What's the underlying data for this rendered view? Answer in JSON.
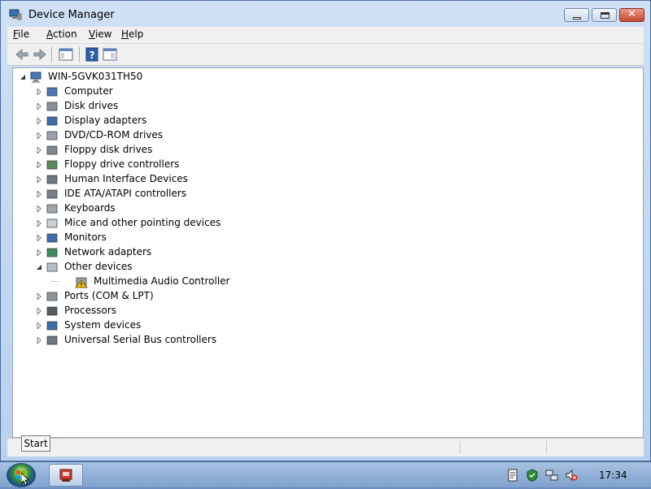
{
  "window": {
    "title": "Device Manager",
    "menu": [
      {
        "mnemonic": "F",
        "rest": "ile"
      },
      {
        "mnemonic": "A",
        "rest": "ction"
      },
      {
        "mnemonic": "V",
        "rest": "iew"
      },
      {
        "mnemonic": "H",
        "rest": "elp"
      }
    ],
    "toolbar": [
      "back-icon",
      "forward-icon",
      "show-hide-console-tree-icon",
      "help-icon",
      "action-pane-icon"
    ],
    "caption_buttons": [
      "minimize-icon",
      "maximize-icon",
      "close-icon"
    ]
  },
  "tree": {
    "root": "WIN-5GVK031TH50",
    "categories": [
      {
        "label": "Computer",
        "icon": "computer-icon"
      },
      {
        "label": "Disk drives",
        "icon": "disk-drive-icon"
      },
      {
        "label": "Display adapters",
        "icon": "display-adapter-icon"
      },
      {
        "label": "DVD/CD-ROM drives",
        "icon": "dvd-drive-icon"
      },
      {
        "label": "Floppy disk drives",
        "icon": "floppy-disk-icon"
      },
      {
        "label": "Floppy drive controllers",
        "icon": "floppy-controller-icon"
      },
      {
        "label": "Human Interface Devices",
        "icon": "hid-icon"
      },
      {
        "label": "IDE ATA/ATAPI controllers",
        "icon": "ide-controller-icon"
      },
      {
        "label": "Keyboards",
        "icon": "keyboard-icon"
      },
      {
        "label": "Mice and other pointing devices",
        "icon": "mouse-icon"
      },
      {
        "label": "Monitors",
        "icon": "monitor-icon"
      },
      {
        "label": "Network adapters",
        "icon": "network-adapter-icon"
      },
      {
        "label": "Other devices",
        "icon": "other-devices-icon",
        "expanded": true
      },
      {
        "label": "Multimedia Audio Controller",
        "icon": "warning-device-icon",
        "child": true
      },
      {
        "label": "Ports (COM & LPT)",
        "icon": "ports-icon"
      },
      {
        "label": "Processors",
        "icon": "processor-icon"
      },
      {
        "label": "System devices",
        "icon": "system-devices-icon"
      },
      {
        "label": "Universal Serial Bus controllers",
        "icon": "usb-icon"
      }
    ]
  },
  "tooltip": "Start",
  "taskbar": {
    "clock": "17:34",
    "tray_icons": [
      "action-center-icon",
      "security-icon",
      "network-icon",
      "volume-muted-icon"
    ]
  },
  "colors": {
    "accent": "#1f6fc9",
    "warning": "#f2c200",
    "window_frame": "#b9d1ee"
  }
}
